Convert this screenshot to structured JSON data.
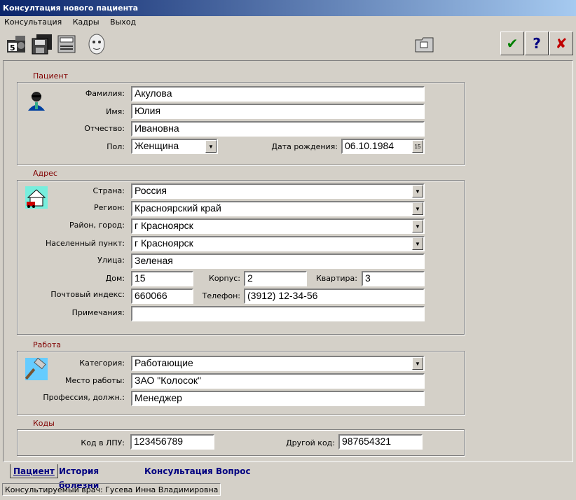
{
  "window": {
    "title": "Консултация нового пациента"
  },
  "menu": [
    "Консультация",
    "Кадры",
    "Выход"
  ],
  "toolbar": {
    "icons": [
      "camera-5-icon",
      "save-disks-icon",
      "printer-icon",
      "face-portrait-icon",
      "folder-icon"
    ],
    "ok": "✔",
    "help": "?",
    "close": "✘"
  },
  "sections": {
    "patient": "Пациент",
    "address": "Адрес",
    "work": "Работа",
    "codes": "Коды"
  },
  "patient": {
    "surname_label": "Фамилия:",
    "surname": "Акулова",
    "name_label": "Имя:",
    "name": "Юлия",
    "patronymic_label": "Отчество:",
    "patronymic": "Ивановна",
    "sex_label": "Пол:",
    "sex": "Женщина",
    "birthdate_label": "Дата рождения:",
    "birthdate": "06.10.1984"
  },
  "address": {
    "country_label": "Страна:",
    "country": "Россия",
    "region_label": "Регион:",
    "region": "Красноярский край",
    "district_label": "Район, город:",
    "district": "г Красноярск",
    "locality_label": "Населенный пункт:",
    "locality": "г Красноярск",
    "street_label": "Улица:",
    "street": "Зеленая",
    "house_label": "Дом:",
    "house": "15",
    "building_label": "Корпус:",
    "building": "2",
    "apartment_label": "Квартира:",
    "apartment": "3",
    "postcode_label": "Почтовый индекс:",
    "postcode": "660066",
    "phone_label": "Телефон:",
    "phone": "(3912) 12-34-56",
    "notes_label": "Примечания:",
    "notes": ""
  },
  "work": {
    "category_label": "Категория:",
    "category": "Работающие",
    "workplace_label": "Место работы:",
    "workplace": "ЗАО \"Колосок\"",
    "profession_label": "Профессия, должн.:",
    "profession": "Менеджер"
  },
  "codes": {
    "lpu_label": "Код в ЛПУ:",
    "lpu": "123456789",
    "other_label": "Другой код:",
    "other": "987654321"
  },
  "tabs": [
    "Пациент",
    "История болезни",
    "Консультация",
    "Вопрос"
  ],
  "status": "Консультируемый врач: Гусева Инна Владимировна"
}
